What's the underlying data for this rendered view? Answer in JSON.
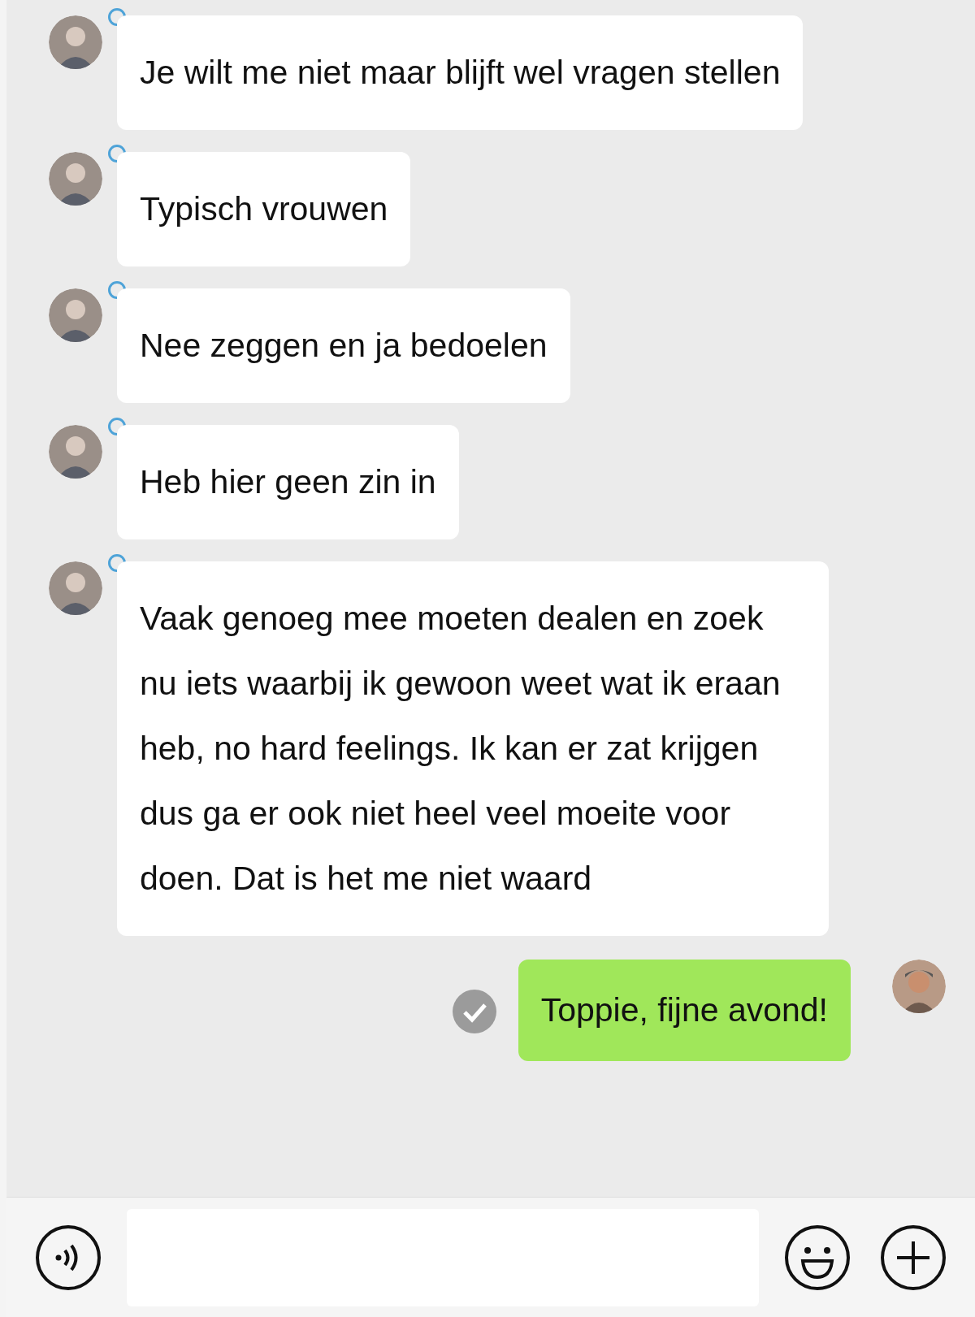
{
  "messages": [
    {
      "kind": "incoming",
      "text": "Je wilt me niet maar blijft wel vragen stellen"
    },
    {
      "kind": "incoming",
      "text": "Typisch vrouwen"
    },
    {
      "kind": "incoming",
      "text": "Nee zeggen en ja bedoelen"
    },
    {
      "kind": "incoming",
      "text": "Heb hier geen zin in"
    },
    {
      "kind": "incoming",
      "text": "Vaak genoeg mee moeten dealen en zoek nu iets waarbij ik gewoon weet wat ik eraan heb, no hard feelings. Ik kan er zat krijgen dus ga er ook niet heel veel moeite voor doen. Dat is het me niet waard"
    },
    {
      "kind": "outgoing",
      "text": "Toppie, fijne avond!"
    }
  ]
}
